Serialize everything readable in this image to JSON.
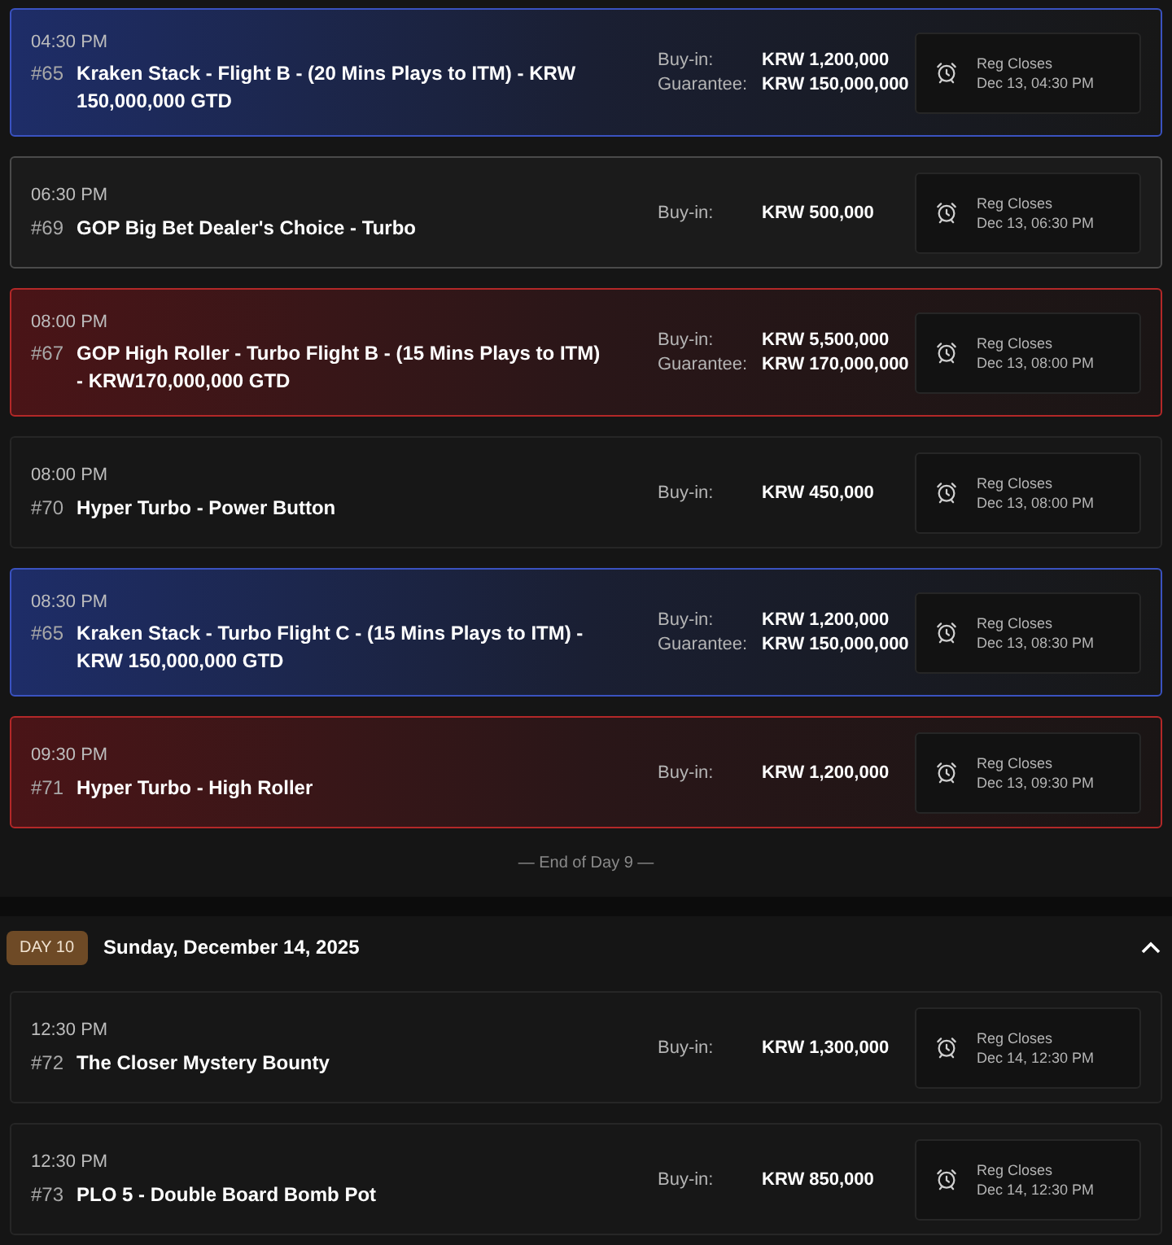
{
  "day9": {
    "events": [
      {
        "kind": "blue",
        "time": "04:30 PM",
        "number": "#65",
        "title": "Kraken Stack - Flight B - (20 Mins Plays to ITM) - KRW 150,000,000 GTD",
        "buy_in_label": "Buy-in:",
        "buy_in": "KRW 1,200,000",
        "guarantee_label": "Guarantee:",
        "guarantee": "KRW 150,000,000",
        "reg_label": "Reg Closes",
        "reg_time": "Dec 13, 04:30 PM"
      },
      {
        "kind": "outlined",
        "time": "06:30 PM",
        "number": "#69",
        "title": "GOP Big Bet Dealer's Choice - Turbo",
        "buy_in_label": "Buy-in:",
        "buy_in": "KRW 500,000",
        "reg_label": "Reg Closes",
        "reg_time": "Dec 13, 06:30 PM"
      },
      {
        "kind": "red",
        "time": "08:00 PM",
        "number": "#67",
        "title": "GOP High Roller - Turbo Flight B - (15 Mins Plays to ITM) - KRW170,000,000 GTD",
        "buy_in_label": "Buy-in:",
        "buy_in": "KRW 5,500,000",
        "guarantee_label": "Guarantee:",
        "guarantee": "KRW 170,000,000",
        "reg_label": "Reg Closes",
        "reg_time": "Dec 13, 08:00 PM"
      },
      {
        "kind": "plain",
        "time": "08:00 PM",
        "number": "#70",
        "title": "Hyper Turbo - Power Button",
        "buy_in_label": "Buy-in:",
        "buy_in": "KRW 450,000",
        "reg_label": "Reg Closes",
        "reg_time": "Dec 13, 08:00 PM"
      },
      {
        "kind": "blue",
        "time": "08:30 PM",
        "number": "#65",
        "title": "Kraken Stack - Turbo Flight C - (15 Mins Plays to ITM) - KRW 150,000,000 GTD",
        "buy_in_label": "Buy-in:",
        "buy_in": "KRW 1,200,000",
        "guarantee_label": "Guarantee:",
        "guarantee": "KRW 150,000,000",
        "reg_label": "Reg Closes",
        "reg_time": "Dec 13, 08:30 PM"
      },
      {
        "kind": "red",
        "time": "09:30 PM",
        "number": "#71",
        "title": "Hyper Turbo - High Roller",
        "buy_in_label": "Buy-in:",
        "buy_in": "KRW 1,200,000",
        "reg_label": "Reg Closes",
        "reg_time": "Dec 13, 09:30 PM"
      }
    ],
    "end_note": "— End of Day 9 —"
  },
  "day10": {
    "badge": "DAY 10",
    "date": "Sunday, December 14, 2025",
    "expanded": true,
    "events": [
      {
        "kind": "plain",
        "time": "12:30 PM",
        "number": "#72",
        "title": "The Closer Mystery Bounty",
        "buy_in_label": "Buy-in:",
        "buy_in": "KRW 1,300,000",
        "reg_label": "Reg Closes",
        "reg_time": "Dec 14, 12:30 PM"
      },
      {
        "kind": "plain",
        "time": "12:30 PM",
        "number": "#73",
        "title": "PLO 5 - Double Board Bomb Pot",
        "buy_in_label": "Buy-in:",
        "buy_in": "KRW 850,000",
        "reg_label": "Reg Closes",
        "reg_time": "Dec 14, 12:30 PM"
      }
    ]
  }
}
